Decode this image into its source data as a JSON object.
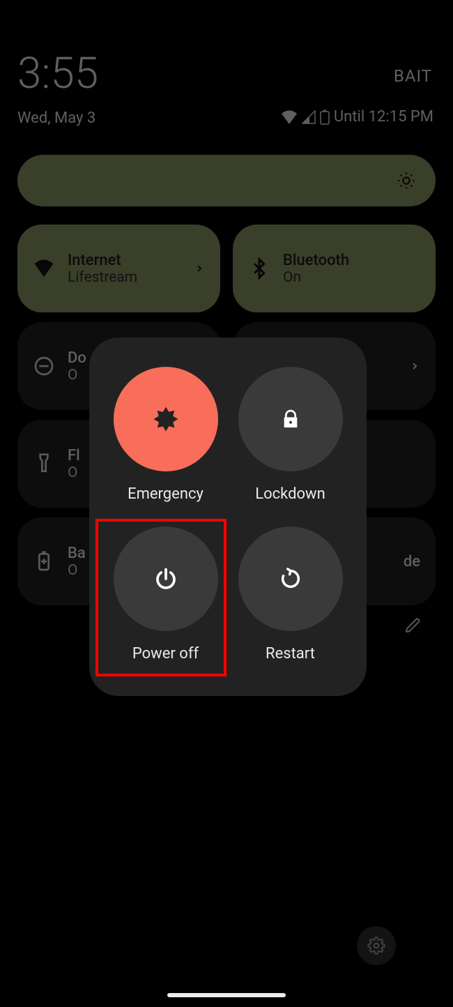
{
  "status": {
    "time": "3:55",
    "date": "Wed, May 3",
    "carrier": "BAIT",
    "battery_until": "Until 12:15 PM"
  },
  "tiles": {
    "internet": {
      "title": "Internet",
      "sub": "Lifestream"
    },
    "bluetooth": {
      "title": "Bluetooth",
      "sub": "On"
    },
    "dnd": {
      "title": "Do",
      "sub": "O"
    },
    "flashlight": {
      "title": "Fl",
      "sub": "O"
    },
    "battery_saver": {
      "title": "Ba",
      "sub": "O"
    },
    "dark_mode": {
      "title": "de"
    }
  },
  "power_menu": {
    "emergency": "Emergency",
    "lockdown": "Lockdown",
    "power_off": "Power off",
    "restart": "Restart"
  },
  "colors": {
    "accent_green": "#808c5b",
    "emergency_red": "#f86e5a",
    "highlight": "#ff0000"
  }
}
